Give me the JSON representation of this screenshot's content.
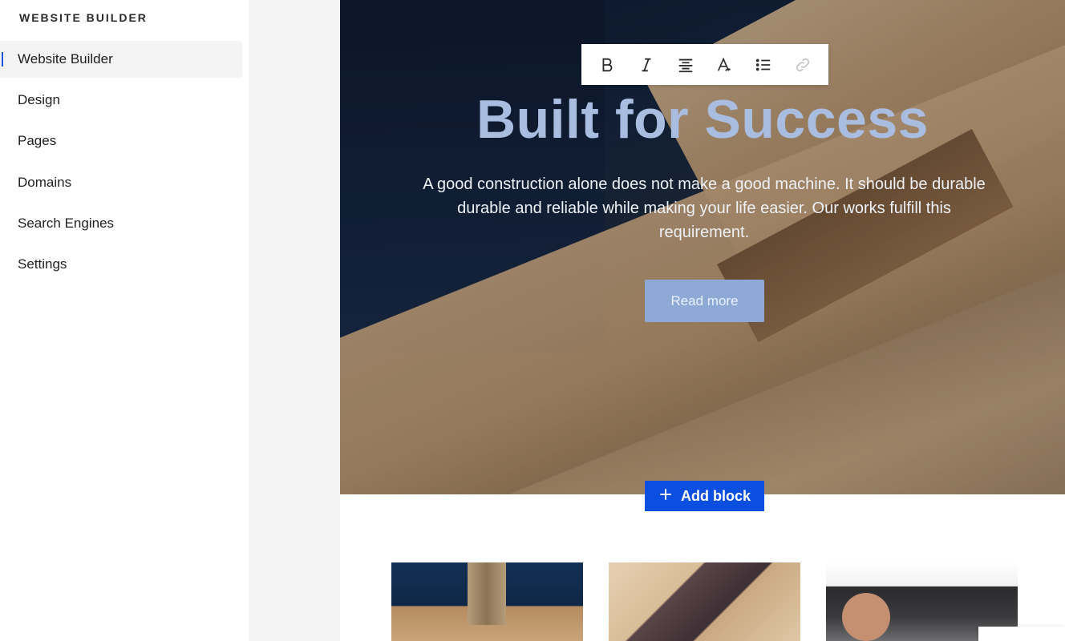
{
  "sidebar": {
    "brand": "WEBSITE BUILDER",
    "items": [
      {
        "label": "Website Builder",
        "active": true
      },
      {
        "label": "Design"
      },
      {
        "label": "Pages"
      },
      {
        "label": "Domains"
      },
      {
        "label": "Search Engines"
      },
      {
        "label": "Settings"
      }
    ]
  },
  "toolbar": {
    "tools": [
      "bold-icon",
      "italic-icon",
      "align-center-icon",
      "font-style-icon",
      "bullet-list-icon",
      "link-icon"
    ]
  },
  "hero": {
    "title": "Built for Success",
    "text": "A good construction alone does not make a good machine. It should be durable durable and reliable while making your life easier. Our works fulfill this requirement.",
    "button_label": "Read more"
  },
  "add_block": {
    "label": "Add block",
    "icon": "plus-icon"
  },
  "colors": {
    "accent": "#0a4fe0",
    "active_indicator": "#1a56db",
    "hero_title": "#a9bde0",
    "read_more_bg": "#8fa9d6"
  }
}
